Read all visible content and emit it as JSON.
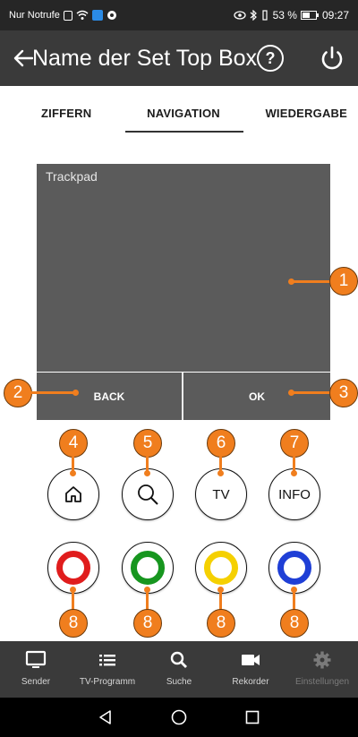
{
  "status_bar": {
    "carrier": "Nur Notrufe",
    "battery": "53 %",
    "time": "09:27"
  },
  "app_bar": {
    "title": "Name der Set Top Box",
    "help_label": "?"
  },
  "tabs": [
    {
      "label": "ZIFFERN",
      "active": false
    },
    {
      "label": "NAVIGATION",
      "active": true
    },
    {
      "label": "WIEDERGABE",
      "active": false
    }
  ],
  "trackpad": {
    "label": "Trackpad",
    "back_label": "BACK",
    "ok_label": "OK"
  },
  "buttons": {
    "home_icon": "home-icon",
    "search_icon": "search-icon",
    "tv_label": "TV",
    "info_label": "INFO",
    "color_keys": [
      {
        "name": "red",
        "color": "#e01d1d"
      },
      {
        "name": "green",
        "color": "#17961f"
      },
      {
        "name": "yellow",
        "color": "#f5d000"
      },
      {
        "name": "blue",
        "color": "#1f3fd6"
      }
    ]
  },
  "callouts": [
    "1",
    "2",
    "3",
    "4",
    "5",
    "6",
    "7",
    "8",
    "8",
    "8",
    "8"
  ],
  "bottom_nav": [
    {
      "label": "Sender",
      "icon": "monitor-icon",
      "enabled": true
    },
    {
      "label": "TV-Programm",
      "icon": "list-icon",
      "enabled": true
    },
    {
      "label": "Suche",
      "icon": "search-icon",
      "enabled": true
    },
    {
      "label": "Rekorder",
      "icon": "video-camera-icon",
      "enabled": true
    },
    {
      "label": "Einstellungen",
      "icon": "gear-icon",
      "enabled": false
    }
  ],
  "colors": {
    "appbar": "#3a3a3a",
    "trackpad": "#5b5b5b",
    "accent": "#f07e1e"
  }
}
